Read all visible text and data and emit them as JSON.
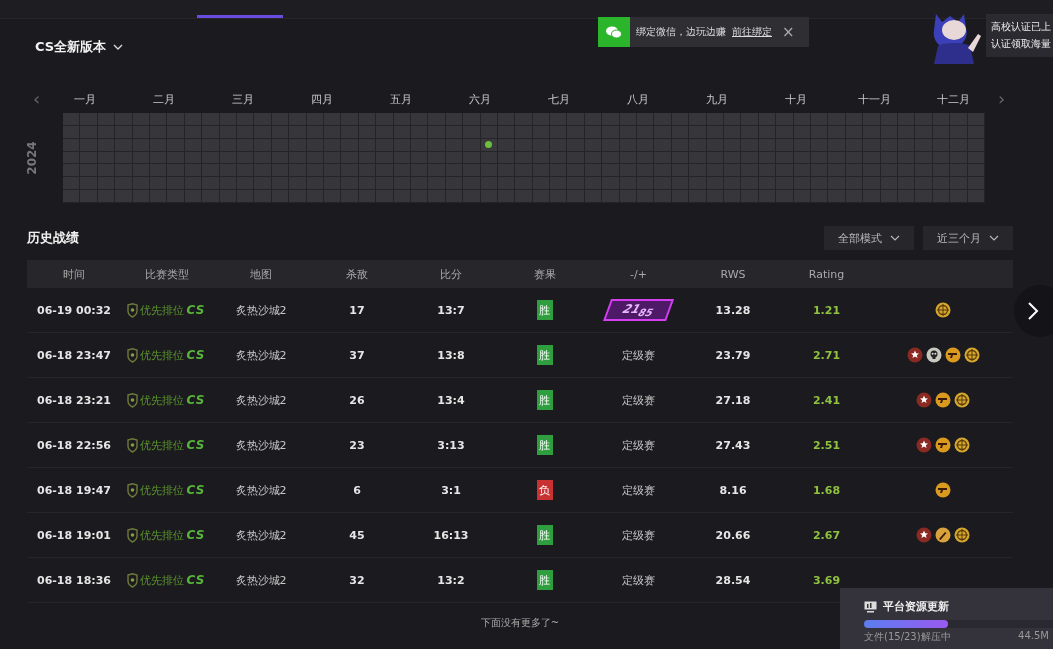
{
  "version_selector": {
    "label": "CS全新版本"
  },
  "toast": {
    "text": "绑定微信，边玩边赚",
    "link": "前往绑定",
    "close": "×"
  },
  "promo": {
    "lines": [
      "高校认证已上",
      "认证领取海量"
    ]
  },
  "heatmap": {
    "months": [
      "一月",
      "二月",
      "三月",
      "四月",
      "五月",
      "六月",
      "七月",
      "八月",
      "九月",
      "十月",
      "十一月",
      "十二月"
    ],
    "prev": "‹",
    "next": "›",
    "year": "2024",
    "weeks": [
      {
        "days": [
          false,
          false,
          false,
          false,
          false,
          false,
          false
        ]
      },
      {
        "days": [
          false,
          false,
          false,
          false,
          false,
          false,
          false
        ]
      },
      {
        "days": [
          false,
          false,
          false,
          false,
          false,
          false,
          false
        ]
      },
      {
        "days": [
          false,
          false,
          false,
          false,
          false,
          false,
          false
        ]
      },
      {
        "days": [
          false,
          false,
          false,
          false,
          false,
          false,
          false
        ]
      },
      {
        "days": [
          false,
          false,
          false,
          false,
          false,
          false,
          false
        ]
      },
      {
        "days": [
          false,
          false,
          false,
          false,
          false,
          false,
          false
        ]
      },
      {
        "days": [
          false,
          false,
          false,
          false,
          false,
          false,
          false
        ]
      },
      {
        "days": [
          false,
          false,
          false,
          false,
          false,
          false,
          false
        ]
      },
      {
        "days": [
          false,
          false,
          false,
          false,
          false,
          false,
          false
        ]
      },
      {
        "days": [
          false,
          false,
          false,
          false,
          false,
          false,
          false
        ]
      },
      {
        "days": [
          false,
          false,
          false,
          false,
          false,
          false,
          false
        ]
      },
      {
        "days": [
          false,
          false,
          false,
          false,
          false,
          false,
          false
        ]
      },
      {
        "days": [
          false,
          false,
          false,
          false,
          false,
          false,
          false
        ]
      },
      {
        "days": [
          false,
          false,
          false,
          false,
          false,
          false,
          false
        ]
      },
      {
        "days": [
          false,
          false,
          false,
          false,
          false,
          false,
          false
        ]
      },
      {
        "days": [
          false,
          false,
          false,
          false,
          false,
          false,
          false
        ]
      },
      {
        "days": [
          false,
          false,
          false,
          false,
          false,
          false,
          false
        ]
      },
      {
        "days": [
          false,
          false,
          false,
          false,
          false,
          false,
          false
        ]
      },
      {
        "days": [
          false,
          false,
          false,
          false,
          false,
          false,
          false
        ]
      },
      {
        "days": [
          false,
          false,
          false,
          false,
          false,
          false,
          false
        ]
      },
      {
        "days": [
          false,
          false,
          false,
          false,
          false,
          false,
          false
        ]
      },
      {
        "days": [
          false,
          false,
          false,
          false,
          false,
          false,
          false
        ]
      },
      {
        "days": [
          false,
          false,
          false,
          false,
          false,
          false,
          false
        ]
      },
      {
        "days": [
          false,
          false,
          true,
          false,
          false,
          false,
          false
        ]
      },
      {
        "days": [
          false,
          false,
          false,
          false,
          false,
          false,
          false
        ]
      },
      {
        "days": [
          false,
          false,
          false,
          false,
          false,
          false,
          false
        ]
      },
      {
        "days": [
          false,
          false,
          false,
          false,
          false,
          false,
          false
        ]
      },
      {
        "days": [
          false,
          false,
          false,
          false,
          false,
          false,
          false
        ]
      },
      {
        "days": [
          false,
          false,
          false,
          false,
          false,
          false,
          false
        ]
      },
      {
        "days": [
          false,
          false,
          false,
          false,
          false,
          false,
          false
        ]
      },
      {
        "days": [
          false,
          false,
          false,
          false,
          false,
          false,
          false
        ]
      },
      {
        "days": [
          false,
          false,
          false,
          false,
          false,
          false,
          false
        ]
      },
      {
        "days": [
          false,
          false,
          false,
          false,
          false,
          false,
          false
        ]
      },
      {
        "days": [
          false,
          false,
          false,
          false,
          false,
          false,
          false
        ]
      },
      {
        "days": [
          false,
          false,
          false,
          false,
          false,
          false,
          false
        ]
      },
      {
        "days": [
          false,
          false,
          false,
          false,
          false,
          false,
          false
        ]
      },
      {
        "days": [
          false,
          false,
          false,
          false,
          false,
          false,
          false
        ]
      },
      {
        "days": [
          false,
          false,
          false,
          false,
          false,
          false,
          false
        ]
      },
      {
        "days": [
          false,
          false,
          false,
          false,
          false,
          false,
          false
        ]
      },
      {
        "days": [
          false,
          false,
          false,
          false,
          false,
          false,
          false
        ]
      },
      {
        "days": [
          false,
          false,
          false,
          false,
          false,
          false,
          false
        ]
      },
      {
        "days": [
          false,
          false,
          false,
          false,
          false,
          false,
          false
        ]
      },
      {
        "days": [
          false,
          false,
          false,
          false,
          false,
          false,
          false
        ]
      },
      {
        "days": [
          false,
          false,
          false,
          false,
          false,
          false,
          false
        ]
      },
      {
        "days": [
          false,
          false,
          false,
          false,
          false,
          false,
          false
        ]
      },
      {
        "days": [
          false,
          false,
          false,
          false,
          false,
          false,
          false
        ]
      },
      {
        "days": [
          false,
          false,
          false,
          false,
          false,
          false,
          false
        ]
      },
      {
        "days": [
          false,
          false,
          false,
          false,
          false,
          false,
          false
        ]
      },
      {
        "days": [
          false,
          false,
          false,
          false,
          false,
          false,
          false
        ]
      },
      {
        "days": [
          false,
          false,
          false,
          false,
          false,
          false,
          false
        ]
      },
      {
        "days": [
          false,
          false,
          false,
          false,
          false,
          false,
          false
        ]
      },
      {
        "days": [
          false,
          false,
          false,
          false,
          false,
          false,
          false
        ]
      }
    ]
  },
  "history": {
    "title": "历史战绩",
    "filters": [
      {
        "label": "全部模式"
      },
      {
        "label": "近三个月"
      }
    ],
    "columns": [
      "时间",
      "比赛类型",
      "地图",
      "杀敌",
      "比分",
      "赛果",
      "-/+",
      "RWS",
      "Rating"
    ],
    "rows": [
      {
        "time": "06-19 00:32",
        "mode": "优先排位",
        "logo": "CS",
        "map": "炙热沙城2",
        "kills": "17",
        "score": "13:7",
        "result": {
          "text": "胜",
          "win": true
        },
        "delta": {
          "kind": "badge",
          "text": "21$_{85}$"
        },
        "rws": "13.28",
        "rating": "1.21",
        "medals": [
          {
            "kind": "target"
          }
        ]
      },
      {
        "time": "06-18 23:47",
        "mode": "优先排位",
        "logo": "CS",
        "map": "炙热沙城2",
        "kills": "37",
        "score": "13:8",
        "result": {
          "text": "胜",
          "win": true
        },
        "delta": {
          "kind": "text",
          "text": "定级赛"
        },
        "rws": "23.79",
        "rating": "2.71",
        "medals": [
          {
            "kind": "star"
          },
          {
            "kind": "skull"
          },
          {
            "kind": "pistol"
          },
          {
            "kind": "target"
          }
        ]
      },
      {
        "time": "06-18 23:21",
        "mode": "优先排位",
        "logo": "CS",
        "map": "炙热沙城2",
        "kills": "26",
        "score": "13:4",
        "result": {
          "text": "胜",
          "win": true
        },
        "delta": {
          "kind": "text",
          "text": "定级赛"
        },
        "rws": "27.18",
        "rating": "2.41",
        "medals": [
          {
            "kind": "star"
          },
          {
            "kind": "pistol"
          },
          {
            "kind": "target"
          }
        ]
      },
      {
        "time": "06-18 22:56",
        "mode": "优先排位",
        "logo": "CS",
        "map": "炙热沙城2",
        "kills": "23",
        "score": "3:13",
        "result": {
          "text": "胜",
          "win": true
        },
        "delta": {
          "kind": "text",
          "text": "定级赛"
        },
        "rws": "27.43",
        "rating": "2.51",
        "medals": [
          {
            "kind": "star"
          },
          {
            "kind": "pistol"
          },
          {
            "kind": "target"
          }
        ]
      },
      {
        "time": "06-18 19:47",
        "mode": "优先排位",
        "logo": "CS",
        "map": "炙热沙城2",
        "kills": "6",
        "score": "3:1",
        "result": {
          "text": "负",
          "win": false
        },
        "delta": {
          "kind": "text",
          "text": "定级赛"
        },
        "rws": "8.16",
        "rating": "1.68",
        "medals": [
          {
            "kind": "pistol"
          }
        ]
      },
      {
        "time": "06-18 19:01",
        "mode": "优先排位",
        "logo": "CS",
        "map": "炙热沙城2",
        "kills": "45",
        "score": "16:13",
        "result": {
          "text": "胜",
          "win": true
        },
        "delta": {
          "kind": "text",
          "text": "定级赛"
        },
        "rws": "20.66",
        "rating": "2.67",
        "medals": [
          {
            "kind": "star"
          },
          {
            "kind": "knife"
          },
          {
            "kind": "target"
          }
        ]
      },
      {
        "time": "06-18 18:36",
        "mode": "优先排位",
        "logo": "CS",
        "map": "炙热沙城2",
        "kills": "32",
        "score": "13:2",
        "result": {
          "text": "胜",
          "win": true
        },
        "delta": {
          "kind": "text",
          "text": "定级赛"
        },
        "rws": "28.54",
        "rating": "3.69"
      }
    ],
    "end_note": "下面没有更多了~"
  },
  "download": {
    "title": "平台资源更新",
    "level": 0.42,
    "status": "文件(15/23)解压中",
    "size": "44.5M"
  }
}
